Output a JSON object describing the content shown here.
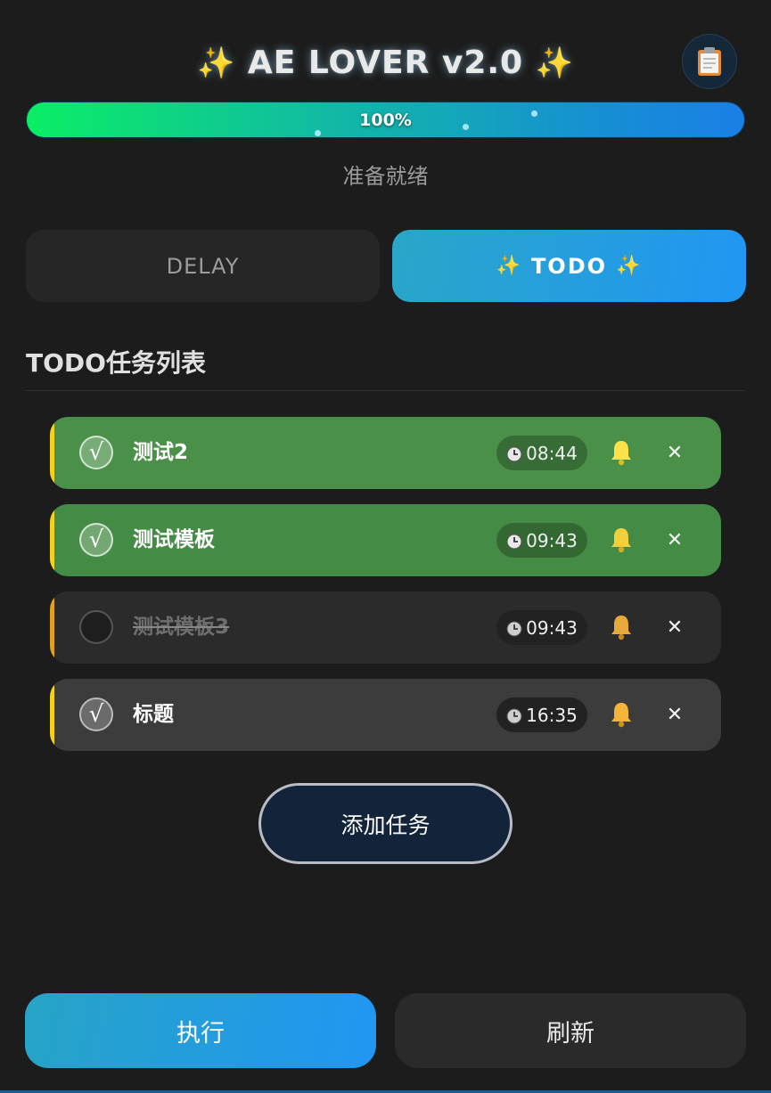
{
  "header": {
    "title": "AE LOVER v2.0",
    "title_sparkle": "✨",
    "clipboard_icon": "clipboard-icon"
  },
  "progress": {
    "value_percent": 100,
    "label": "100%"
  },
  "status_text": "准备就绪",
  "tabs": [
    {
      "label": "DELAY",
      "active": false
    },
    {
      "label": "TODO",
      "active": true,
      "sparkle": "✨"
    }
  ],
  "section": {
    "title": "TODO任务列表"
  },
  "tasks": [
    {
      "label": "测试2",
      "done": true,
      "time": "08:44",
      "bell_color": "#ffe14a"
    },
    {
      "label": "测试模板",
      "done": true,
      "time": "09:43",
      "bell_color": "#f3cf3e"
    },
    {
      "label": "测试模板3",
      "done": false,
      "time": "09:43",
      "bell_color": "#e6a93a"
    },
    {
      "label": "标题",
      "done": true,
      "time": "16:35",
      "bell_color": "#f2b53a"
    }
  ],
  "check_mark": "√",
  "delete_glyph": "✕",
  "add_button": {
    "label": "添加任务"
  },
  "bottom": {
    "execute_label": "执行",
    "refresh_label": "刷新"
  },
  "colors": {
    "accent": "#2196f3",
    "done_green": "#4a9048",
    "stripe_yellow": "#f4d21a"
  }
}
